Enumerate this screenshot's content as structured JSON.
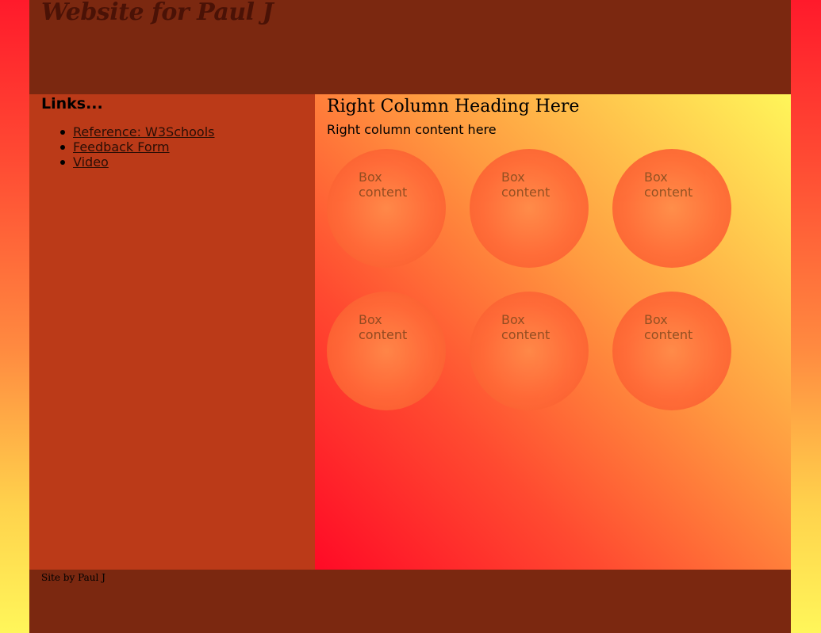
{
  "header": {
    "title": "Website for Paul J"
  },
  "sidebar": {
    "heading": "Links...",
    "links": [
      {
        "label": "Reference: W3Schools"
      },
      {
        "label": "Feedback Form"
      },
      {
        "label": "Video"
      }
    ]
  },
  "main": {
    "heading": "Right Column Heading Here",
    "content": "Right column content here",
    "boxes": [
      {
        "label": "Box content"
      },
      {
        "label": "Box content"
      },
      {
        "label": "Box content"
      },
      {
        "label": "Box content"
      },
      {
        "label": "Box content"
      },
      {
        "label": "Box content"
      }
    ]
  },
  "footer": {
    "text": "Site by Paul J"
  },
  "colors": {
    "header_bg": "#7b2810",
    "sidebar_bg": "#bb3a18",
    "circle": "#ff6a38"
  }
}
